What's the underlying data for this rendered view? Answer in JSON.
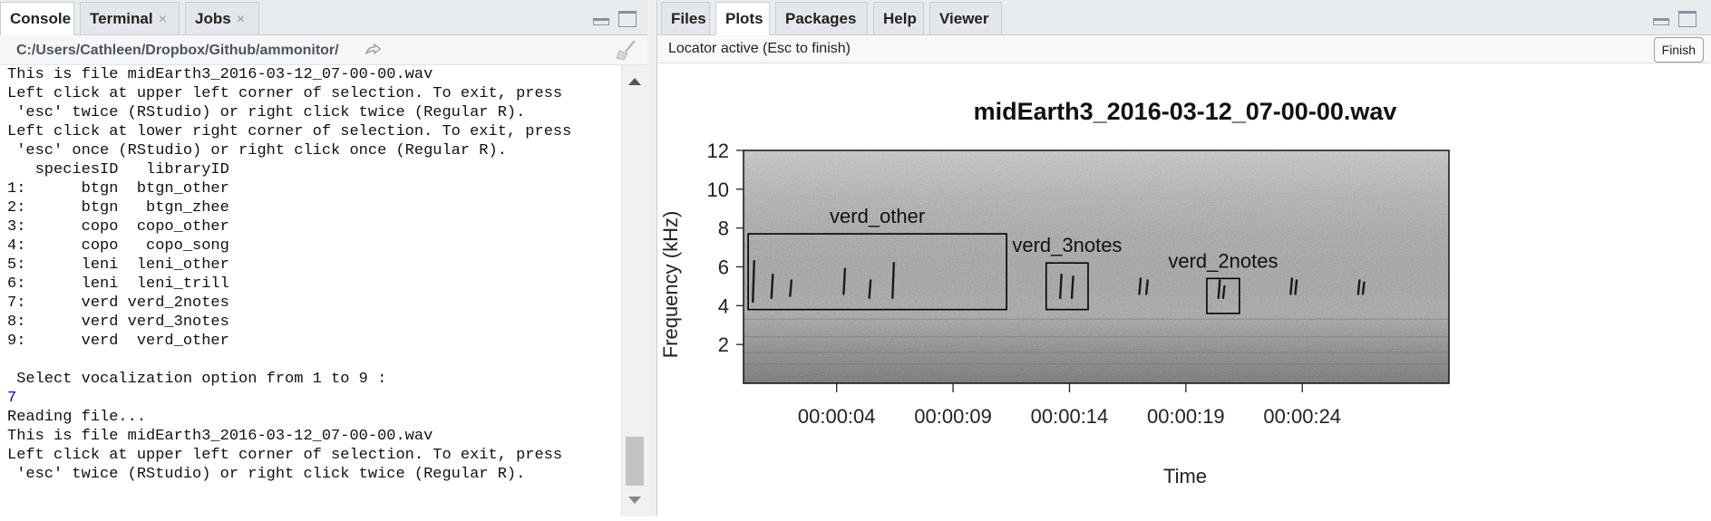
{
  "left_pane": {
    "tabs": [
      {
        "label": "Console",
        "closable": false
      },
      {
        "label": "Terminal",
        "closable": true
      },
      {
        "label": "Jobs",
        "closable": true
      }
    ],
    "close_glyph": "×",
    "path": "C:/Users/Cathleen/Dropbox/Github/ammonitor/",
    "path_icon": "arrow-right-icon",
    "clear_icon": "broom-icon",
    "console_lines": [
      {
        "text": "This is file midEarth3_2016-03-12_07-00-00.wav",
        "kind": "output"
      },
      {
        "text": "Left click at upper left corner of selection. To exit, press",
        "kind": "output"
      },
      {
        "text": " 'esc' twice (RStudio) or right click twice (Regular R).",
        "kind": "output"
      },
      {
        "text": "Left click at lower right corner of selection. To exit, press",
        "kind": "output"
      },
      {
        "text": " 'esc' once (RStudio) or right click once (Regular R).",
        "kind": "output"
      },
      {
        "text": "   speciesID   libraryID",
        "kind": "output"
      },
      {
        "text": "1:      btgn  btgn_other",
        "kind": "output"
      },
      {
        "text": "2:      btgn   btgn_zhee",
        "kind": "output"
      },
      {
        "text": "3:      copo  copo_other",
        "kind": "output"
      },
      {
        "text": "4:      copo   copo_song",
        "kind": "output"
      },
      {
        "text": "5:      leni  leni_other",
        "kind": "output"
      },
      {
        "text": "6:      leni  leni_trill",
        "kind": "output"
      },
      {
        "text": "7:      verd verd_2notes",
        "kind": "output"
      },
      {
        "text": "8:      verd verd_3notes",
        "kind": "output"
      },
      {
        "text": "9:      verd  verd_other",
        "kind": "output"
      },
      {
        "text": "",
        "kind": "output"
      },
      {
        "text": " Select vocalization option from 1 to 9 :",
        "kind": "output"
      },
      {
        "text": "7",
        "kind": "input"
      },
      {
        "text": "Reading file...",
        "kind": "output"
      },
      {
        "text": "This is file midEarth3_2016-03-12_07-00-00.wav",
        "kind": "output"
      },
      {
        "text": "Left click at upper left corner of selection. To exit, press",
        "kind": "output"
      },
      {
        "text": " 'esc' twice (RStudio) or right click twice (Regular R).",
        "kind": "output"
      }
    ]
  },
  "right_pane": {
    "tabs": [
      "Files",
      "Plots",
      "Packages",
      "Help",
      "Viewer"
    ],
    "active_tab": "Plots",
    "locator_text": "Locator active (Esc to finish)",
    "finish_label": "Finish"
  },
  "plot": {
    "title": "midEarth3_2016-03-12_07-00-00.wav",
    "ylabel": "Frequency (kHz)",
    "xlabel": "Time",
    "y_ticks": [
      "2",
      "4",
      "6",
      "8",
      "10",
      "12"
    ],
    "x_ticks": [
      "00:00:04",
      "00:00:09",
      "00:00:14",
      "00:00:19",
      "00:00:24"
    ],
    "x_tick_seconds": [
      4,
      9,
      14,
      19,
      24
    ],
    "xlim_seconds": [
      0,
      30.3
    ],
    "ylim_khz": [
      0,
      12
    ],
    "annotations": [
      {
        "label": "verd_other",
        "t_start": 0.2,
        "t_end": 11.3,
        "f_low": 3.8,
        "f_high": 7.7
      },
      {
        "label": "verd_3notes",
        "t_start": 13.0,
        "t_end": 14.8,
        "f_low": 3.8,
        "f_high": 6.2
      },
      {
        "label": "verd_2notes",
        "t_start": 19.9,
        "t_end": 21.3,
        "f_low": 3.6,
        "f_high": 5.4
      }
    ],
    "colors": {
      "spectrogram_bg": "#9a9a9a",
      "box": "#000000"
    }
  }
}
